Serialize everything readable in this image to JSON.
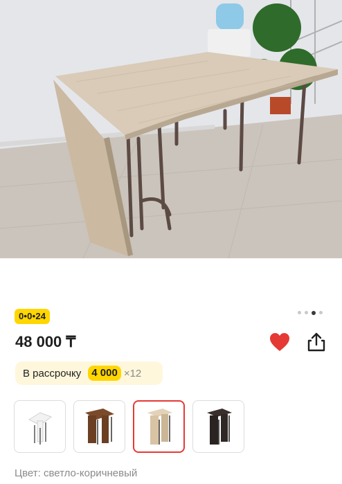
{
  "gallery": {
    "image_alt": "folding table",
    "page_count": 4,
    "active_page": 3
  },
  "badge": {
    "label": "0•0•24"
  },
  "price": {
    "text": "48 000 ₸"
  },
  "actions": {
    "favorite_icon": "heart-icon",
    "share_icon": "share-icon",
    "favorite_color": "#e53935"
  },
  "installment": {
    "label": "В рассрочку",
    "amount": "4 000",
    "multiplier": "×12"
  },
  "variants": [
    {
      "name": "white",
      "color": "#f2f2f2",
      "selected": false
    },
    {
      "name": "walnut",
      "color": "#7a4a2a",
      "selected": false
    },
    {
      "name": "light-brown",
      "color": "#d8c3a4",
      "selected": true
    },
    {
      "name": "dark",
      "color": "#2a2322",
      "selected": false
    }
  ],
  "color_info": {
    "prefix": "Цвет:",
    "value": "светло-коричневый"
  },
  "colors": {
    "accent_yellow": "#ffd600",
    "selected_border": "#e53935"
  }
}
